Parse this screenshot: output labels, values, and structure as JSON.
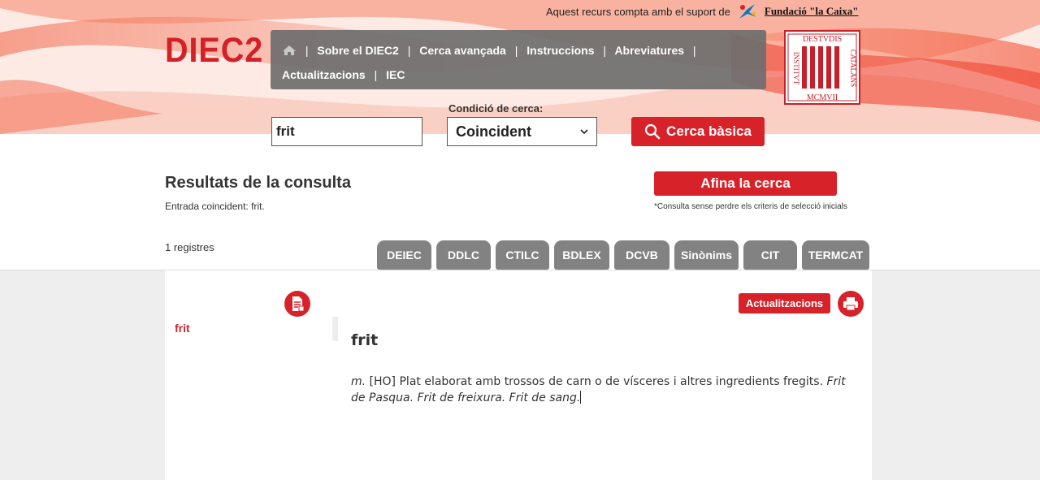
{
  "sponsor": {
    "text": "Aquest recurs compta amb el suport de",
    "brand": "Fundació \"la Caixa\""
  },
  "logo": "DIEC2",
  "nav": {
    "items": [
      "Sobre el DIEC2",
      "Cerca avançada",
      "Instruccions",
      "Abreviatures",
      "Actualitzacions",
      "IEC"
    ]
  },
  "seal": {
    "top": "DESTVDIS",
    "left": "INSTITVT",
    "right": "CATALANS",
    "bottom": "MCMVII"
  },
  "search": {
    "condition_label": "Condició de cerca:",
    "query": "frit",
    "condition": "Coincident",
    "button": "Cerca bàsica"
  },
  "results": {
    "title": "Resultats de la consulta",
    "subtitle": "Entrada coincident: frit.",
    "refine_button": "Afina la cerca",
    "refine_note": "*Consulta sense perdre els criteris de selecció inicials",
    "count": "1 registres"
  },
  "dictionaries": [
    "DEIEC",
    "DDLC",
    "CTILC",
    "BDLEX",
    "DCVB",
    "Sinònims",
    "CIT",
    "TERMCAT"
  ],
  "entry": {
    "side_item": "frit",
    "updates_button": "Actualitzacions",
    "headword": "frit",
    "pos": "m.",
    "domain": "[HO]",
    "definition": "Plat elaborat amb trossos de carn o de vísceres i altres ingredients fregits.",
    "examples": "Frit de Pasqua. Frit de freixura. Frit de sang."
  },
  "colors": {
    "brand_red": "#d8222a",
    "nav_gray": "#6e6e6e",
    "dict_gray": "#828282"
  }
}
